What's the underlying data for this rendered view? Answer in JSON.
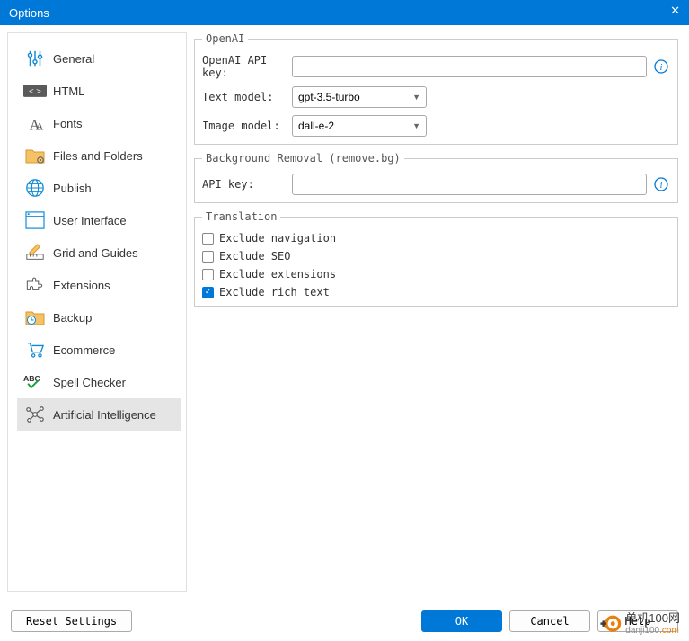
{
  "title": "Options",
  "sidebar": {
    "items": [
      {
        "label": "General"
      },
      {
        "label": "HTML"
      },
      {
        "label": "Fonts"
      },
      {
        "label": "Files and Folders"
      },
      {
        "label": "Publish"
      },
      {
        "label": "User Interface"
      },
      {
        "label": "Grid and Guides"
      },
      {
        "label": "Extensions"
      },
      {
        "label": "Backup"
      },
      {
        "label": "Ecommerce"
      },
      {
        "label": "Spell Checker"
      },
      {
        "label": "Artificial Intelligence"
      }
    ]
  },
  "openai": {
    "legend": "OpenAI",
    "api_key_label": "OpenAI API key:",
    "api_key_value": "",
    "text_model_label": "Text model:",
    "text_model_value": "gpt-3.5-turbo",
    "image_model_label": "Image model:",
    "image_model_value": "dall-e-2"
  },
  "bg": {
    "legend": "Background Removal (remove.bg)",
    "api_key_label": "API key:",
    "api_key_value": ""
  },
  "translation": {
    "legend": "Translation",
    "exclude_nav": "Exclude navigation",
    "exclude_seo": "Exclude SEO",
    "exclude_ext": "Exclude extensions",
    "exclude_rich": "Exclude rich text",
    "checked": {
      "nav": false,
      "seo": false,
      "ext": false,
      "rich": true
    }
  },
  "footer": {
    "reset": "Reset Settings",
    "ok": "OK",
    "cancel": "Cancel",
    "help": "Help"
  },
  "watermark": {
    "brand": "单机100网",
    "domain_grey": "danji100",
    "domain_orange": ".com"
  }
}
